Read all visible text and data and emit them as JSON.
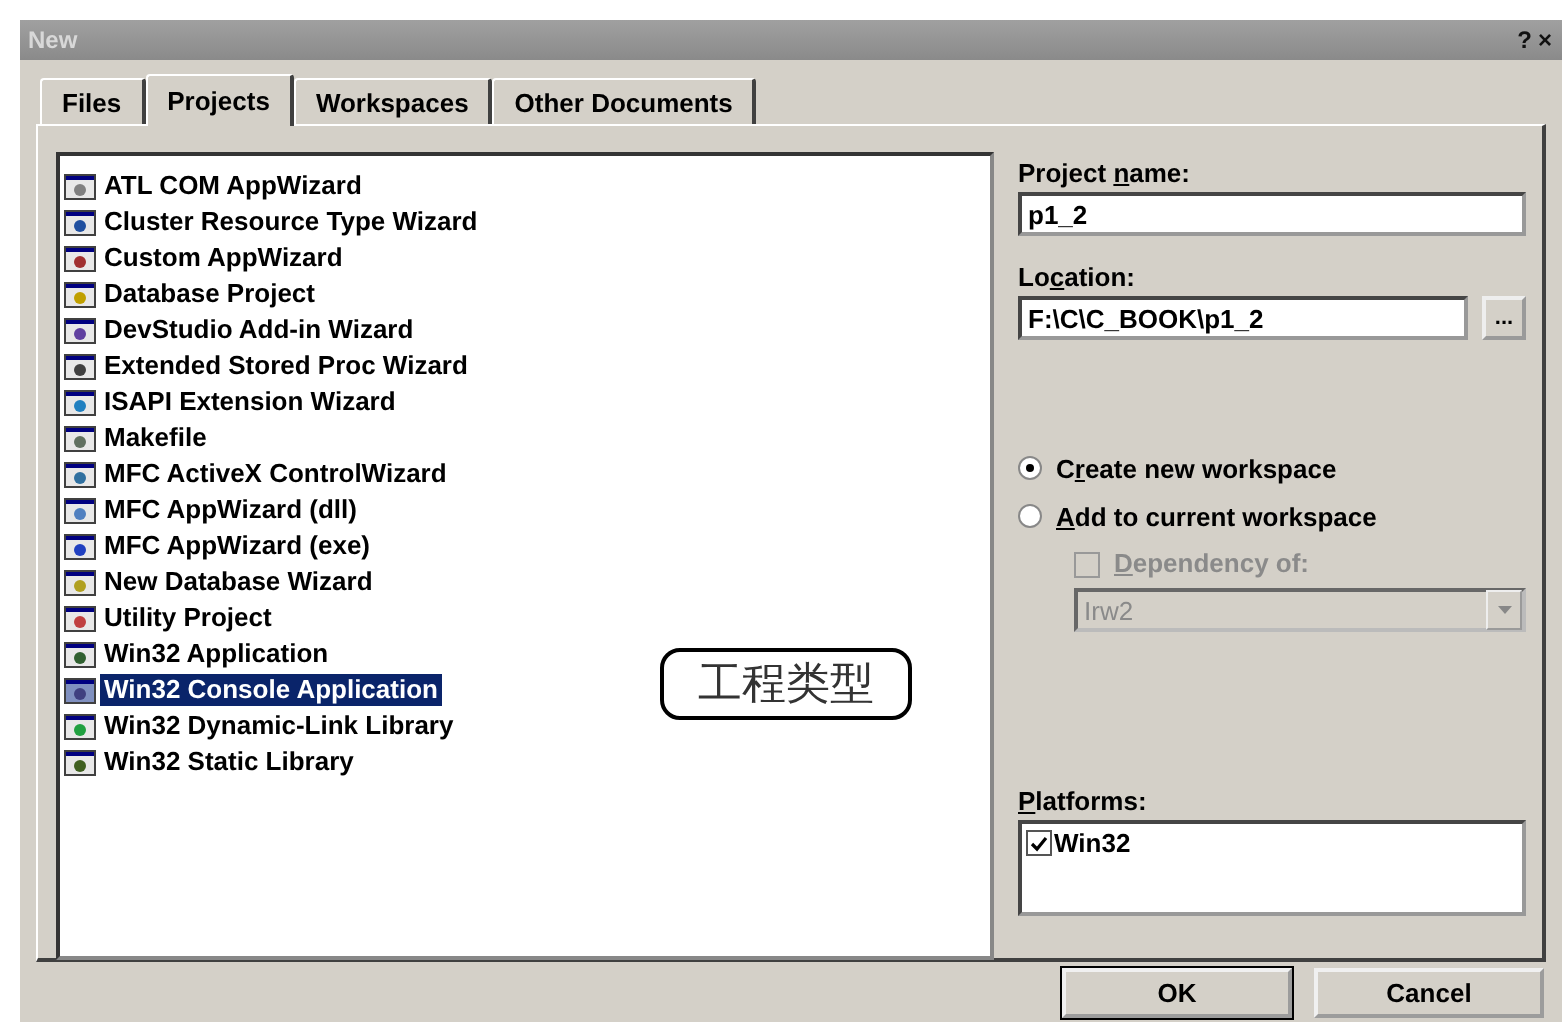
{
  "window": {
    "title": "New",
    "title_buttons": [
      "?",
      "×"
    ]
  },
  "tabs": [
    {
      "label": "Files",
      "selected": false
    },
    {
      "label": "Projects",
      "selected": true
    },
    {
      "label": "Workspaces",
      "selected": false
    },
    {
      "label": "Other Documents",
      "selected": false
    }
  ],
  "project_types": [
    {
      "label": "ATL COM AppWizard",
      "selected": false
    },
    {
      "label": "Cluster Resource Type Wizard",
      "selected": false
    },
    {
      "label": "Custom AppWizard",
      "selected": false
    },
    {
      "label": "Database Project",
      "selected": false
    },
    {
      "label": "DevStudio Add-in Wizard",
      "selected": false
    },
    {
      "label": "Extended Stored Proc Wizard",
      "selected": false
    },
    {
      "label": "ISAPI Extension Wizard",
      "selected": false
    },
    {
      "label": "Makefile",
      "selected": false
    },
    {
      "label": "MFC ActiveX ControlWizard",
      "selected": false
    },
    {
      "label": "MFC AppWizard (dll)",
      "selected": false
    },
    {
      "label": "MFC AppWizard (exe)",
      "selected": false
    },
    {
      "label": "New Database Wizard",
      "selected": false
    },
    {
      "label": "Utility Project",
      "selected": false
    },
    {
      "label": "Win32 Application",
      "selected": false
    },
    {
      "label": "Win32 Console Application",
      "selected": true
    },
    {
      "label": "Win32 Dynamic-Link Library",
      "selected": false
    },
    {
      "label": "Win32 Static Library",
      "selected": false
    }
  ],
  "annotation": {
    "text": "工程类型"
  },
  "project_name": {
    "label_parts": {
      "before": "Project ",
      "key": "n",
      "after": "ame:"
    },
    "value": "p1_2"
  },
  "location": {
    "label_parts": {
      "before": "Lo",
      "key": "c",
      "after": "ation:"
    },
    "value": "F:\\C\\C_BOOK\\p1_2",
    "browse": "..."
  },
  "workspace_options": [
    {
      "label_parts": {
        "before": "C",
        "key": "r",
        "after": "eate new workspace"
      },
      "selected": true
    },
    {
      "label_parts": {
        "key": "A",
        "after": "dd to current workspace"
      },
      "selected": false
    }
  ],
  "dependency": {
    "label_parts": {
      "key": "D",
      "after": "ependency of:"
    },
    "checked": false,
    "disabled": true,
    "value": "Irw2"
  },
  "platforms": {
    "label_parts": {
      "key": "P",
      "after": "latforms:"
    },
    "items": [
      {
        "label": "Win32",
        "checked": true
      }
    ]
  },
  "buttons": [
    "OK",
    "Cancel"
  ]
}
